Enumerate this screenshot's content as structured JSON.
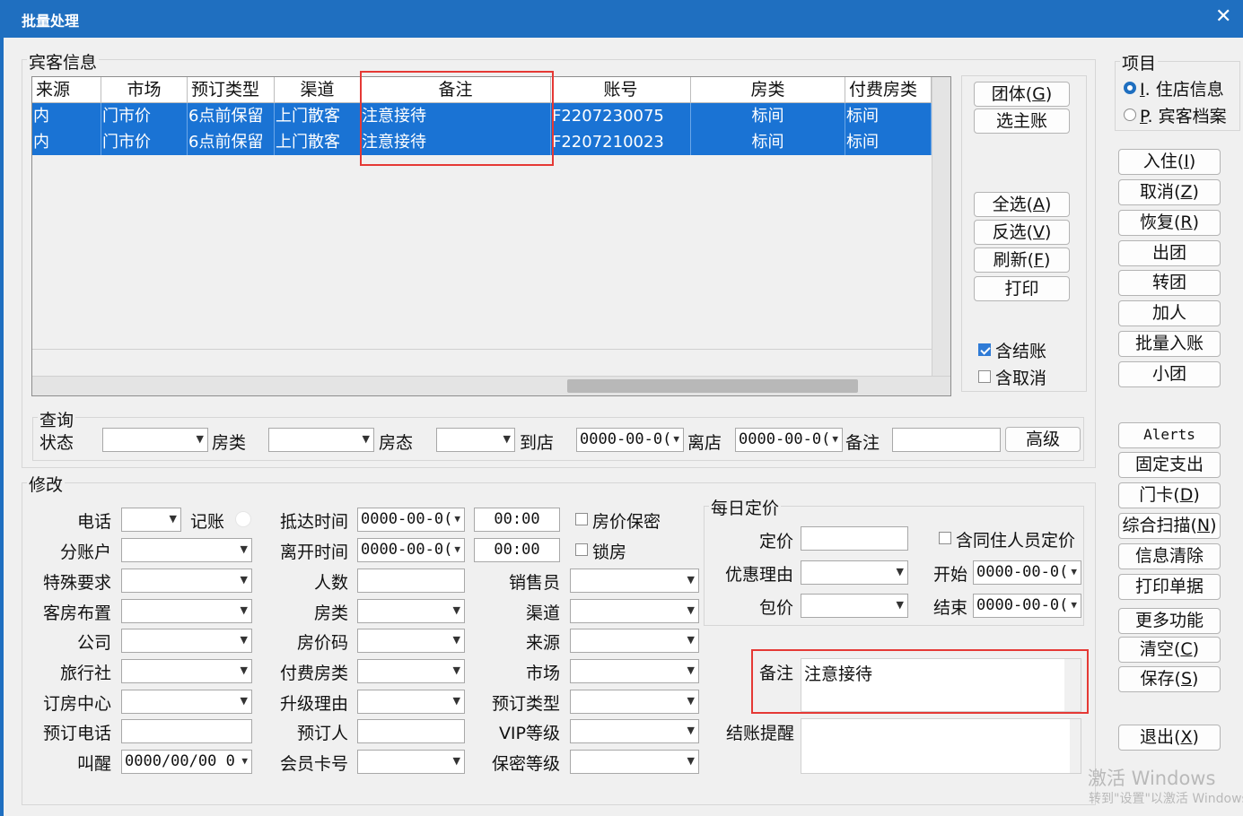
{
  "window": {
    "title": "批量处理",
    "close_glyph": "✕"
  },
  "guest": {
    "legend": "宾客信息",
    "columns": [
      "来源",
      "市场",
      "预订类型",
      "渠道",
      "备注",
      "账号",
      "房类",
      "付费房类"
    ],
    "rows": [
      [
        "内",
        "门市价",
        "6点前保留",
        "上门散客",
        "注意接待",
        "F2207230075",
        "标间",
        "标间"
      ],
      [
        "内",
        "门市价",
        "6点前保留",
        "上门散客",
        "注意接待",
        "F2207210023",
        "标间",
        "标间"
      ]
    ]
  },
  "middle_buttons": {
    "group": "团体",
    "group_key": "G",
    "select_master": "选主账",
    "select_all": "全选",
    "select_all_key": "A",
    "invert": "反选",
    "invert_key": "V",
    "refresh": "刷新",
    "refresh_key": "F",
    "print": "打印"
  },
  "checks": {
    "include_settled": "含结账",
    "include_cancelled": "含取消"
  },
  "project": {
    "legend": "项目",
    "option1_key": "I",
    "option1": "住店信息",
    "option2_key": "P",
    "option2": "宾客档案"
  },
  "right_buttons": [
    {
      "text": "入住",
      "key": "I"
    },
    {
      "text": "取消",
      "key": "Z"
    },
    {
      "text": "恢复",
      "key": "R"
    },
    {
      "text": "出团",
      "key": ""
    },
    {
      "text": "转团",
      "key": ""
    },
    {
      "text": "加人",
      "key": ""
    },
    {
      "text": "批量入账",
      "key": ""
    },
    {
      "text": "小团",
      "key": ""
    },
    {
      "text": "Alerts",
      "key": ""
    },
    {
      "text": "固定支出",
      "key": ""
    },
    {
      "text": "门卡",
      "key": "D"
    },
    {
      "text": "综合扫描",
      "key": "N"
    },
    {
      "text": "信息清除",
      "key": ""
    },
    {
      "text": "打印单据",
      "key": ""
    },
    {
      "text": "更多功能",
      "key": ""
    },
    {
      "text": "清空",
      "key": "C"
    },
    {
      "text": "保存",
      "key": "S"
    },
    {
      "text": "退出",
      "key": "X"
    }
  ],
  "query": {
    "legend": "查询",
    "status": "状态",
    "room_type": "房类",
    "room_status": "房态",
    "arrive": "到店",
    "arrive_val": "0000-00-0(",
    "depart": "离店",
    "depart_val": "0000-00-0(",
    "remark": "备注",
    "advanced": "高级"
  },
  "edit": {
    "legend": "修改",
    "phone": "电话",
    "charge": "记账",
    "sub_account": "分账户",
    "special_req": "特殊要求",
    "room_layout": "客房布置",
    "company": "公司",
    "travel_agency": "旅行社",
    "booking_center": "订房中心",
    "booking_phone": "预订电话",
    "wakeup": "叫醒",
    "wakeup_val": "0000/00/00 0",
    "arrive_time": "抵达时间",
    "arrive_date": "0000-00-0(",
    "arrive_clock": "00:00",
    "leave_time": "离开时间",
    "leave_date": "0000-00-0(",
    "leave_clock": "00:00",
    "people": "人数",
    "room_type": "房类",
    "rate_code": "房价码",
    "pay_room_type": "付费房类",
    "upgrade_reason": "升级理由",
    "booker": "预订人",
    "member_card": "会员卡号",
    "rate_secret": "房价保密",
    "lock_room": "锁房",
    "salesperson": "销售员",
    "channel": "渠道",
    "source": "来源",
    "market": "市场",
    "booking_type": "预订类型",
    "vip_level": "VIP等级",
    "secret_level": "保密等级"
  },
  "daily_rate": {
    "legend": "每日定价",
    "price": "定价",
    "include_cohabitant": "含同住人员定价",
    "discount_reason": "优惠理由",
    "start": "开始",
    "start_val": "0000-00-0(",
    "package": "包价",
    "end": "结束",
    "end_val": "0000-00-0("
  },
  "remark": {
    "label": "备注",
    "value": "注意接待"
  },
  "checkout_reminder": {
    "label": "结账提醒"
  },
  "watermark": {
    "line1": "激活 Windows",
    "line2": "转到\"设置\"以激活 Windows"
  }
}
